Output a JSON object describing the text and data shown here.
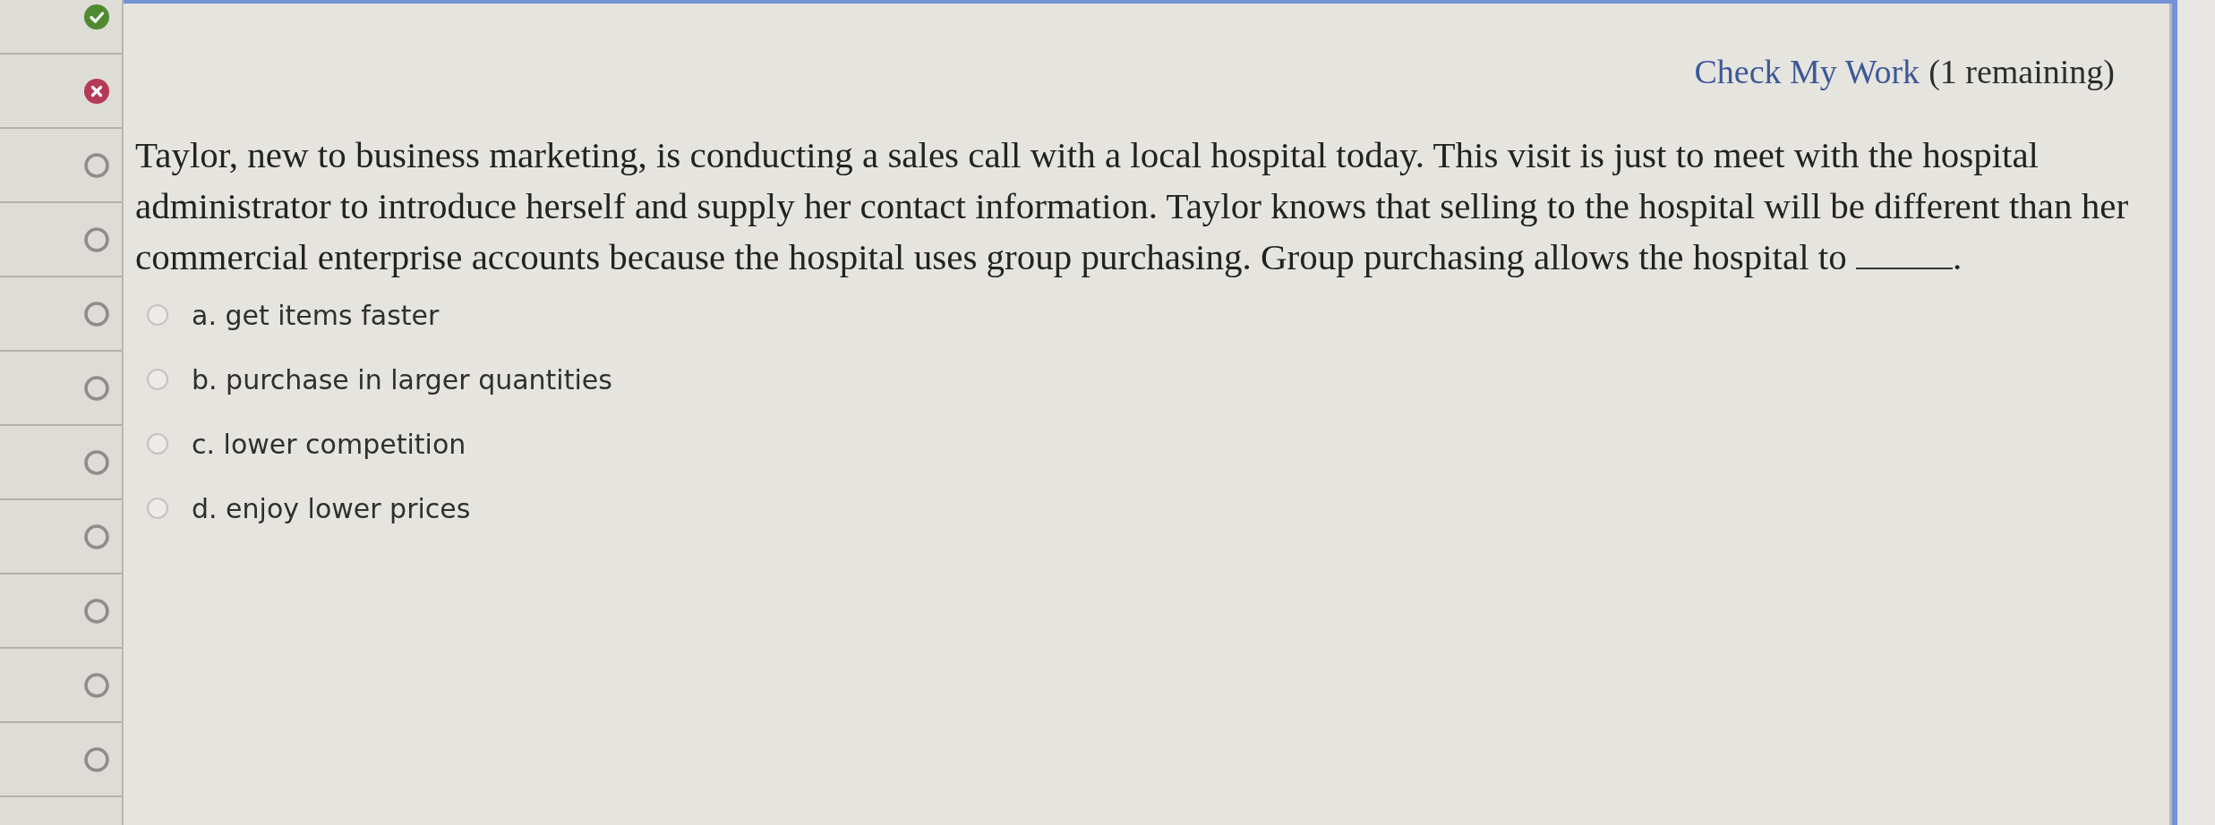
{
  "nav": {
    "questions": [
      {
        "kind": "correct"
      },
      {
        "kind": "incorrect"
      },
      {
        "kind": "unanswered"
      },
      {
        "kind": "unanswered"
      },
      {
        "kind": "unanswered"
      },
      {
        "kind": "unanswered"
      },
      {
        "kind": "unanswered"
      },
      {
        "kind": "unanswered"
      },
      {
        "kind": "unanswered"
      },
      {
        "kind": "unanswered"
      },
      {
        "kind": "unanswered"
      }
    ]
  },
  "check_work": {
    "link": "Check My Work",
    "remaining": "(1 remaining)"
  },
  "question": {
    "text": "Taylor, new to business marketing, is conducting a sales call with a local hospital today. This visit is just to meet with the hospital administrator to introduce herself and supply her contact information. Taylor knows that selling to the hospital will be different than her commercial enterprise accounts because the hospital uses group purchasing. Group purchasing allows the hospital to",
    "suffix": "."
  },
  "options": [
    {
      "label": "a. get items faster",
      "selected": false
    },
    {
      "label": "b. purchase in larger quantities",
      "selected": false
    },
    {
      "label": "c. lower competition",
      "selected": false
    },
    {
      "label": "d. enjoy lower prices",
      "selected": false
    }
  ]
}
